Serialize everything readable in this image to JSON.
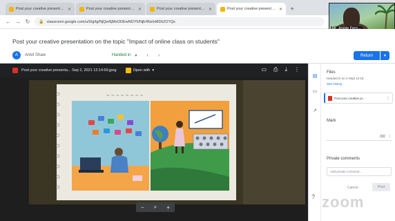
{
  "browser": {
    "tabs": [
      {
        "title": "Post your creative presentation",
        "color": "#f4b400",
        "active": false
      },
      {
        "title": "Post your creative presentation",
        "color": "#f4b400",
        "active": false
      },
      {
        "title": "Post your creative presentation",
        "color": "#f4b400",
        "active": false
      },
      {
        "title": "Post your creative presentation",
        "color": "#f4b400",
        "active": true
      }
    ],
    "url": "classroom.google.com/u/0/g/tg/NjQwNjMxODEwNDY5/NjE4NzIxMDk2OTQx"
  },
  "header": {
    "assignment_title": "Post your creative presentation on the topic \"Impact of online class on students\"",
    "student_name": "Ankit Shaw",
    "student_initial": "A",
    "status": "Handed in",
    "pager_prev": "‹",
    "pager_next": "›",
    "return_label": "Return",
    "return_caret": "▾"
  },
  "video": {
    "participant_name": "Dr. Jessie Fern..."
  },
  "viewer": {
    "file_name": "Post your creative presenta... Sep 2, 2021 12:14:59.jpeg",
    "open_with": "Open with",
    "zoom_out": "−",
    "zoom_icon": "⌕",
    "zoom_in": "+"
  },
  "panel": {
    "files_label": "Files",
    "handed_in_text": "Handed in on 2 Sept 12:16",
    "see_history": "See history",
    "file_card_name": "Post your creative pr...",
    "mark_label": "Mark",
    "grade_value": "/10",
    "private_comments_label": "Private comments",
    "private_comments_placeholder": "Add private comment...",
    "cancel_label": "Cancel",
    "post_label": "Post"
  },
  "watermark": "zoom",
  "colors": {
    "accent": "#1a73e8",
    "status_green": "#188038"
  }
}
